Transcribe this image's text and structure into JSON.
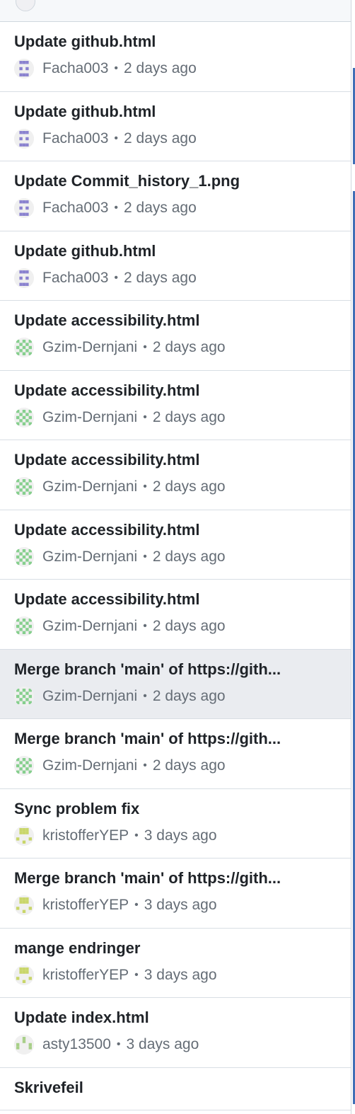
{
  "colors": {
    "selected_row_bg": "#eaecf0",
    "text_primary": "#1f2328",
    "text_muted": "#656d76",
    "accent_blue": "#3f6fb6"
  },
  "avatar_palette": {
    "Facha003": "#8a82cf",
    "Gzim-Dernjani": "#86cf8e",
    "kristofferYEP": "#c9d66a",
    "asty13500": "#a8cf88"
  },
  "commits": [
    {
      "message": "Update github.html",
      "author": "Facha003",
      "separator": "•",
      "time": "2 days ago",
      "avatar_icon": "identicon-purple-icon"
    },
    {
      "message": "Update github.html",
      "author": "Facha003",
      "separator": "•",
      "time": "2 days ago",
      "avatar_icon": "identicon-purple-icon"
    },
    {
      "message": "Update Commit_history_1.png",
      "author": "Facha003",
      "separator": "•",
      "time": "2 days ago",
      "avatar_icon": "identicon-purple-icon"
    },
    {
      "message": "Update github.html",
      "author": "Facha003",
      "separator": "•",
      "time": "2 days ago",
      "avatar_icon": "identicon-purple-icon"
    },
    {
      "message": "Update accessibility.html",
      "author": "Gzim-Dernjani",
      "separator": "•",
      "time": "2 days ago",
      "avatar_icon": "identicon-green-icon"
    },
    {
      "message": "Update accessibility.html",
      "author": "Gzim-Dernjani",
      "separator": "•",
      "time": "2 days ago",
      "avatar_icon": "identicon-green-icon"
    },
    {
      "message": "Update accessibility.html",
      "author": "Gzim-Dernjani",
      "separator": "•",
      "time": "2 days ago",
      "avatar_icon": "identicon-green-icon"
    },
    {
      "message": "Update accessibility.html",
      "author": "Gzim-Dernjani",
      "separator": "•",
      "time": "2 days ago",
      "avatar_icon": "identicon-green-icon"
    },
    {
      "message": "Update accessibility.html",
      "author": "Gzim-Dernjani",
      "separator": "•",
      "time": "2 days ago",
      "avatar_icon": "identicon-green-icon"
    },
    {
      "message": "Merge branch 'main' of https://gith...",
      "author": "Gzim-Dernjani",
      "separator": "•",
      "time": "2 days ago",
      "avatar_icon": "identicon-green-icon",
      "selected": true
    },
    {
      "message": "Merge branch 'main' of https://gith...",
      "author": "Gzim-Dernjani",
      "separator": "•",
      "time": "2 days ago",
      "avatar_icon": "identicon-green-icon"
    },
    {
      "message": "Sync problem fix",
      "author": "kristofferYEP",
      "separator": "•",
      "time": "3 days ago",
      "avatar_icon": "identicon-yellow-icon"
    },
    {
      "message": "Merge branch 'main' of https://gith...",
      "author": "kristofferYEP",
      "separator": "•",
      "time": "3 days ago",
      "avatar_icon": "identicon-yellow-icon"
    },
    {
      "message": "mange endringer",
      "author": "kristofferYEP",
      "separator": "•",
      "time": "3 days ago",
      "avatar_icon": "identicon-yellow-icon"
    },
    {
      "message": "Update index.html",
      "author": "asty13500",
      "separator": "•",
      "time": "3 days ago",
      "avatar_icon": "identicon-lightgreen-icon"
    }
  ],
  "last_commit": {
    "message": "Skrivefeil"
  }
}
